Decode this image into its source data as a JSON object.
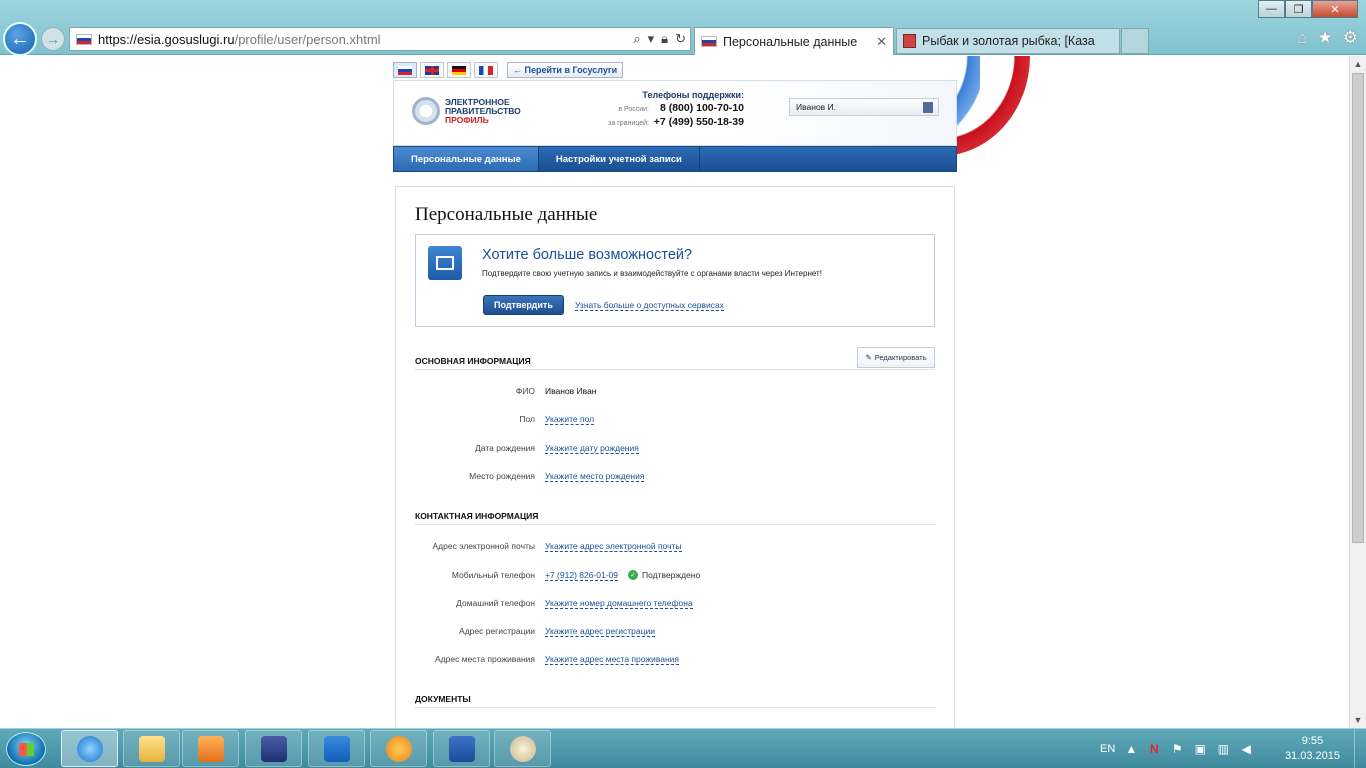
{
  "browser": {
    "url_host": "https://esia.gosuslugi.ru",
    "url_path": "/profile/user/person.xhtml",
    "tabs": [
      {
        "label": "Персональные данные",
        "active": true
      },
      {
        "label": "Рыбак и золотая рыбка; [Каза",
        "active": false
      }
    ],
    "win_controls": {
      "min": "—",
      "max": "❐",
      "close": "✕"
    }
  },
  "site": {
    "languages": [
      "ru",
      "en",
      "de",
      "fr"
    ],
    "goto_link": "← Перейти в Госуслуги",
    "logo_line1": "ЭЛЕКТРОННОЕ",
    "logo_line2": "ПРАВИТЕЛЬСТВО",
    "logo_line3": "ПРОФИЛЬ",
    "support_title": "Телефоны поддержки:",
    "support_ru_label": "в России:",
    "support_ru_phone": "8 (800) 100-70-10",
    "support_abroad_label": "за границей:",
    "support_abroad_phone": "+7 (499) 550-18-39",
    "user_name": "Иванов И.",
    "nav": [
      "Персональные данные",
      "Настройки учетной записи"
    ]
  },
  "content": {
    "title": "Персональные данные",
    "promo_title": "Хотите больше возможностей?",
    "promo_text": "Подтвердите свою учетную запись и взаимодействуйте с органами власти через Интернет!",
    "confirm_button": "Подтвердить",
    "learn_more": "Узнать больше о доступных сервисах",
    "edit_button": "Редактировать",
    "section_main": "ОСНОВНАЯ ИНФОРМАЦИЯ",
    "section_contact": "КОНТАКТНАЯ ИНФОРМАЦИЯ",
    "section_docs": "ДОКУМЕНТЫ",
    "main_fields": [
      {
        "label": "ФИО",
        "value": "Иванов Иван"
      },
      {
        "label": "Пол",
        "value": "Укажите пол"
      },
      {
        "label": "Дата рождения",
        "value": "Укажите дату рождения"
      },
      {
        "label": "Место рождения",
        "value": "Укажите место рождения"
      }
    ],
    "contact_fields": [
      {
        "label": "Адрес электронной почты",
        "value": "Укажите адрес электронной почты"
      },
      {
        "label": "Мобильный телефон",
        "value": "+7 (912) 826-01-09",
        "status": "Подтверждено"
      },
      {
        "label": "Домашний телефон",
        "value": "Укажите номер домашнего телефона"
      },
      {
        "label": "Адрес регистрации",
        "value": "Укажите адрес регистрации"
      },
      {
        "label": "Адрес места проживания",
        "value": "Укажите адрес места проживания"
      }
    ]
  },
  "taskbar": {
    "lang": "EN",
    "time": "9:55",
    "date": "31.03.2015"
  }
}
